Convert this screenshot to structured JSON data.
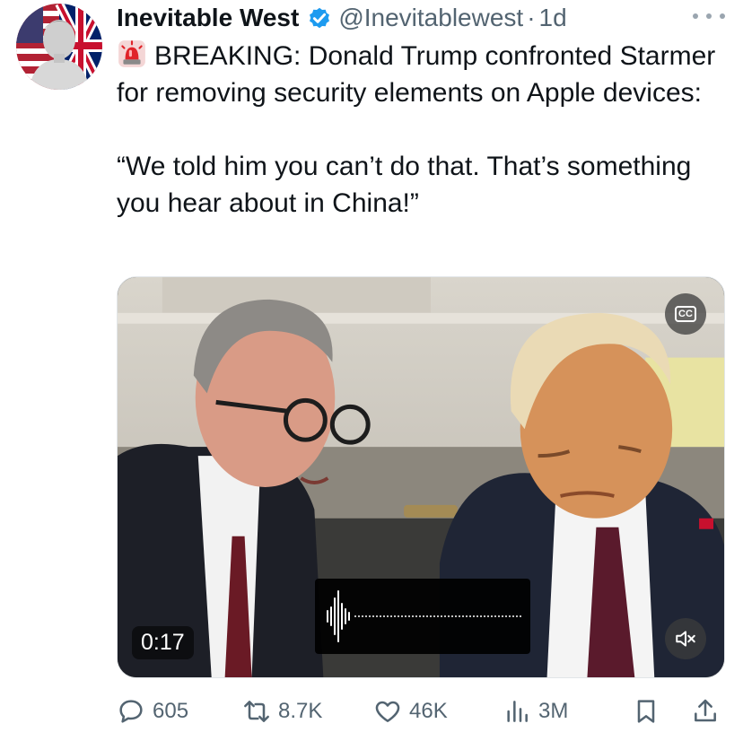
{
  "author": {
    "name": "Inevitable West",
    "handle": "@Inevitablewest",
    "separator": "·",
    "time": "1d",
    "avatar_icon": "statue-with-flags-avatar",
    "verified_icon": "verified-badge-icon",
    "verified_color": "#1d9bf0"
  },
  "tweet": {
    "siren_icon": "rotating-light-emoji",
    "line1": "BREAKING: Donald Trump confronted Starmer for removing security elements on Apple devices:",
    "quote": "“We told him you can’t do that. That’s something you hear about in China!”"
  },
  "video": {
    "timestamp": "0:17",
    "cc_label": "CC",
    "cc_icon": "closed-captions-icon",
    "mute_icon": "speaker-muted-icon",
    "waveform_icon": "audio-waveform-icon"
  },
  "actions": {
    "replies": "605",
    "reposts": "8.7K",
    "likes": "46K",
    "views": "3M"
  },
  "colors": {
    "text": "#0f1419",
    "secondary": "#536471",
    "accent": "#1d9bf0"
  }
}
